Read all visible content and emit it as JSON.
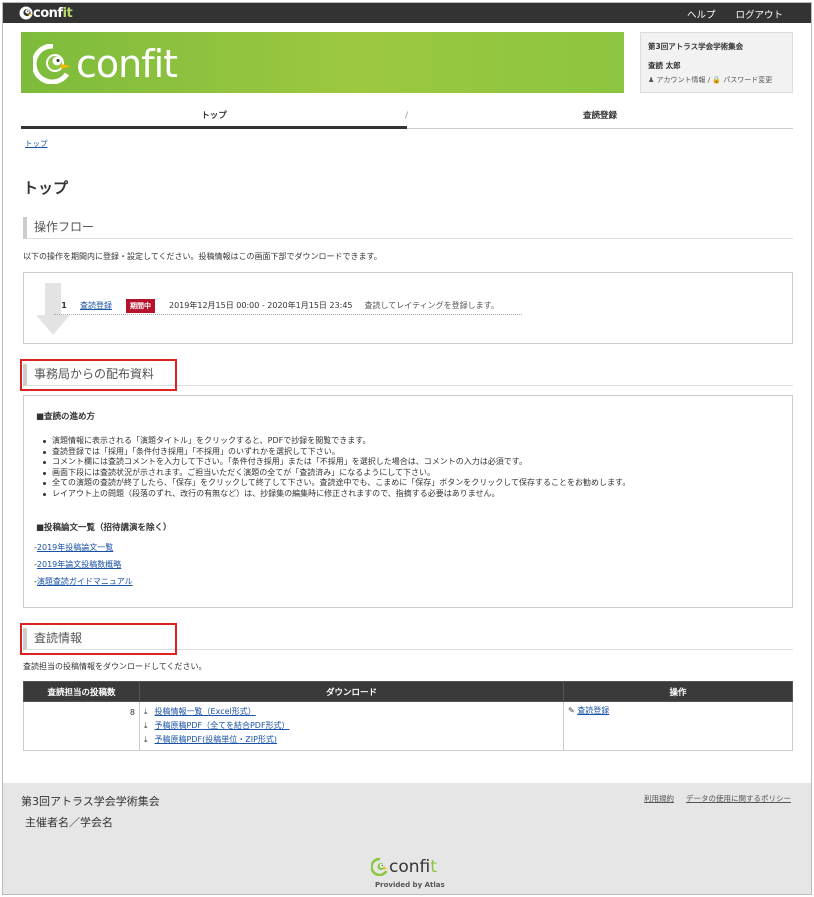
{
  "topbar": {
    "help": "ヘルプ",
    "logout": "ログアウト",
    "logo_text": "conf",
    "logo_it": "it"
  },
  "banner": {
    "logo_text": "confit"
  },
  "user": {
    "conference": "第3回アトラス学会学術集会",
    "name": "査読 太郎",
    "account_link": "アカウント情報",
    "separator": "/",
    "password_link": "パスワード変更"
  },
  "tabs": [
    {
      "label": "トップ",
      "active": true
    },
    {
      "label": "査読登録",
      "active": false
    }
  ],
  "tab_separator": "/",
  "breadcrumb": "トップ",
  "page_title": "トップ",
  "flow": {
    "heading": "操作フロー",
    "description": "以下の操作を期間内に登録・設定してください。投稿情報はこの画面下部でダウンロードできます。",
    "rows": [
      {
        "num": "1",
        "link": "査読登録",
        "badge": "期間中",
        "period": "2019年12月15日 00:00 - 2020年1月15日 23:45",
        "note": "査読してレイティングを登録します。"
      }
    ]
  },
  "distribution": {
    "heading": "事務局からの配布資料",
    "section1_title": "■査読の進め方",
    "bullets": [
      "演題情報に表示される「演題タイトル」をクリックすると、PDFで抄録を閲覧できます。",
      "査読登録では「採用」「条件付き採用」「不採用」のいずれかを選択して下さい。",
      "コメント欄には査読コメントを入力して下さい。「条件付き採用」または「不採用」を選択した場合は、コメントの入力は必須です。",
      "画面下段には査読状況が示されます。ご担当いただく演題の全てが「査読済み」になるようにして下さい。",
      "全ての演題の査読が終了したら、「保存」をクリックして終了して下さい。査読途中でも、こまめに「保存」ボタンをクリックして保存することをお勧めします。",
      "レイアウト上の問題（段落のずれ、改行の有無など）は、抄録集の編集時に修正されますので、指摘する必要はありません。"
    ],
    "section2_title": "■投稿論文一覧（招待講演を除く）",
    "links": [
      "2019年投稿論文一覧",
      "2019年論文投稿数概略",
      "演題査読ガイドマニュアル"
    ],
    "link_prefix": "-"
  },
  "review": {
    "heading": "査読情報",
    "description": "査読担当の投稿情報をダウンロードしてください。",
    "columns": [
      "査読担当の投稿数",
      "ダウンロード",
      "操作"
    ],
    "count": "8",
    "downloads": [
      "投稿情報一覧（Excel形式）",
      "予稿原稿PDF（全てを結合PDF形式）",
      "予稿原稿PDF(投稿単位・ZIP形式)"
    ],
    "action": "査読登録"
  },
  "footer": {
    "name": "第3回アトラス学会学術集会",
    "organizer": "主催者名／学会名",
    "links": [
      "利用規約",
      "データの使用に関するポリシー"
    ],
    "logo_text": "conf",
    "logo_it": "it",
    "provided": "Provided by Atlas"
  },
  "colors": {
    "banner_green": "#8cc540",
    "badge_red": "#b5132b",
    "highlight_red": "#dd2222",
    "topbar": "#333333"
  }
}
